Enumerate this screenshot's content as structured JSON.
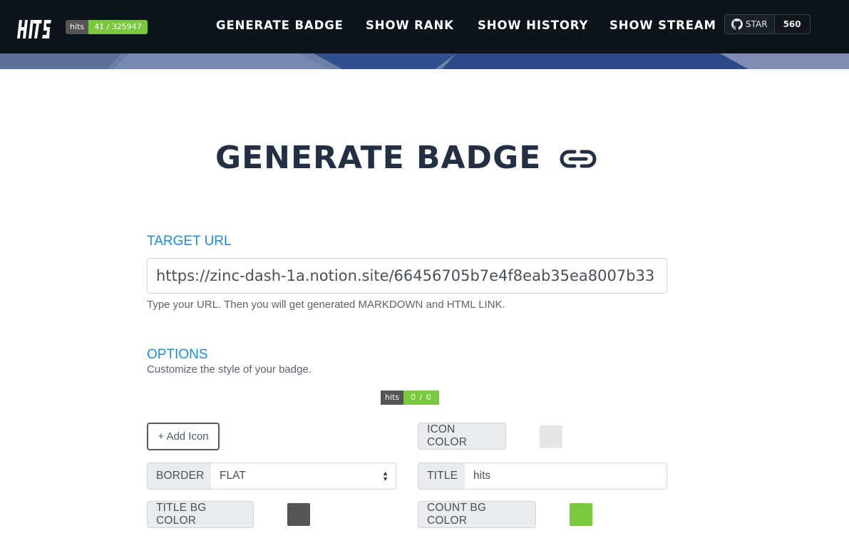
{
  "navbar": {
    "logo_text": "HITS",
    "hits_badge": {
      "title": "hits",
      "count": "41 / 325947"
    },
    "links": [
      "GENERATE BADGE",
      "SHOW RANK",
      "SHOW HISTORY",
      "SHOW STREAM"
    ],
    "github": {
      "star_label": "STAR",
      "star_count": "560"
    }
  },
  "main": {
    "title": "GENERATE BADGE",
    "target_url": {
      "label": "TARGET URL",
      "value": "https://zinc-dash-1a.notion.site/66456705b7e4f8eab35ea8007b33",
      "help": "Type your URL. Then you will get generated MARKDOWN and HTML LINK."
    },
    "options": {
      "label": "OPTIONS",
      "help": "Customize the style of your badge.",
      "preview_badge": {
        "title": "hits",
        "count": "0 / 0"
      },
      "add_icon_label": "+ Add Icon",
      "icon_color_label": "ICON COLOR",
      "border_label": "BORDER",
      "border_value": "FLAT",
      "title_label": "TITLE",
      "title_value": "hits",
      "title_bg_color_label": "TITLE BG COLOR",
      "count_bg_color_label": "COUNT BG COLOR"
    }
  },
  "colors": {
    "navbar_bg": "#0e141c",
    "accent_blue": "#1d8be0",
    "heading": "#233044",
    "icon_color": "#e6e6e6",
    "title_bg_color": "#555555",
    "count_bg_color": "#79c83d"
  }
}
